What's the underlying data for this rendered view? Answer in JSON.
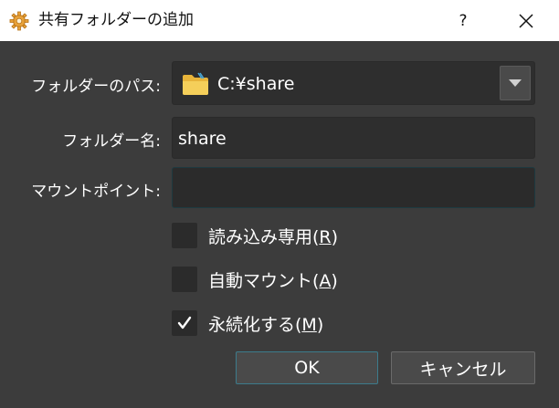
{
  "window": {
    "title": "共有フォルダーの追加",
    "help_label": "?",
    "close_icon": "close-icon",
    "app_icon": "gear-icon"
  },
  "form": {
    "folder_path_label": "フォルダーのパス:",
    "folder_path_value": "C:¥share",
    "folder_icon": "folder-icon",
    "folder_name_label": "フォルダー名:",
    "folder_name_value": "share",
    "mount_point_label": "マウントポイント:",
    "mount_point_value": ""
  },
  "options": [
    {
      "text": "読み込み専用(",
      "mnemonic": "R",
      "suffix": ")",
      "checked": false
    },
    {
      "text": "自動マウント(",
      "mnemonic": "A",
      "suffix": ")",
      "checked": false
    },
    {
      "text": "永続化する(",
      "mnemonic": "M",
      "suffix": ")",
      "checked": true
    }
  ],
  "buttons": {
    "ok": "OK",
    "cancel": "キャンセル"
  },
  "colors": {
    "background": "#3c3c3c",
    "field": "#2b2b2b",
    "focus_border": "#3c7c8c"
  }
}
